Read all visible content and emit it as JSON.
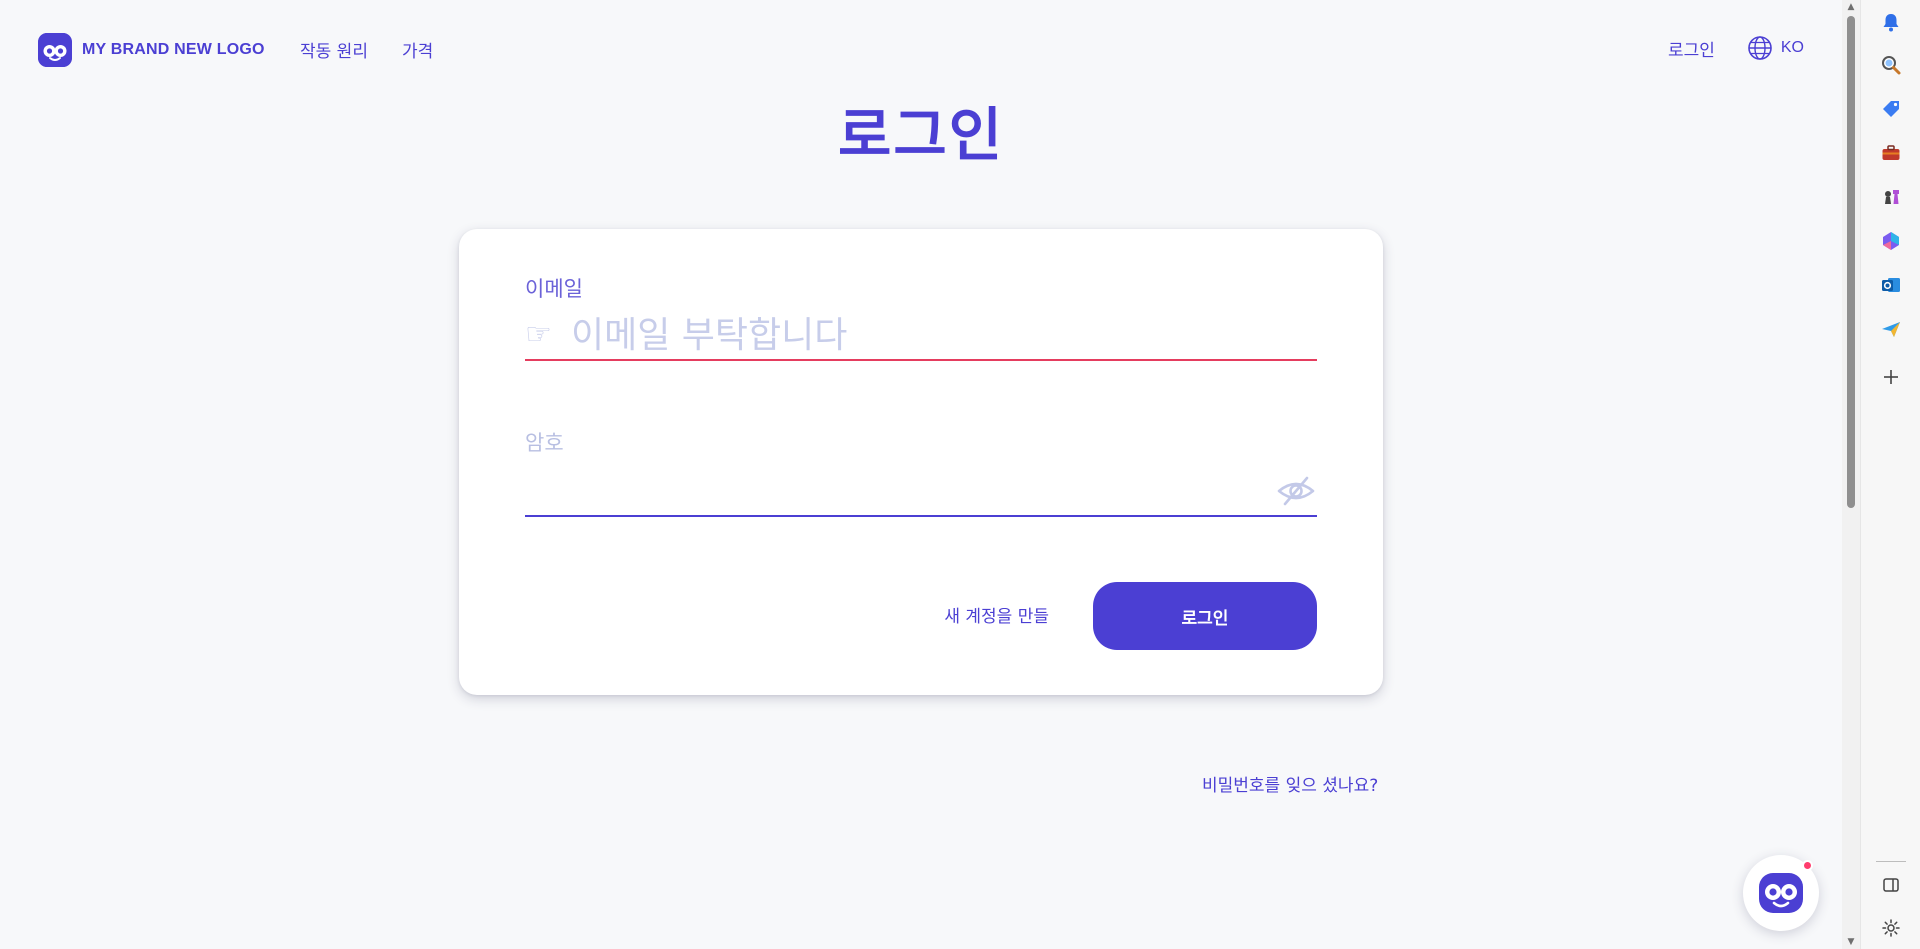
{
  "header": {
    "brand": {
      "name": "MY BRAND NEW LOGO",
      "logo_icon": "mascot-logo-icon"
    },
    "nav": [
      {
        "label": "작동 원리"
      },
      {
        "label": "가격"
      }
    ],
    "login_label": "로그인",
    "language": {
      "code": "KO",
      "icon": "globe-icon"
    }
  },
  "page": {
    "title": "로그인"
  },
  "form": {
    "email": {
      "label": "이메일",
      "placeholder": "이메일 부탁합니다",
      "value": "",
      "icon": "pointing-hand-icon",
      "icon_glyph": "☞",
      "error_color": "#e53d5e"
    },
    "password": {
      "label": "암호",
      "value": "",
      "toggle_icon": "eye-off-icon"
    },
    "create_account_label": "새 계정을 만들",
    "submit_label": "로그인"
  },
  "footer": {
    "forgot_password": "비밀번호를 잊으 셨나요?"
  },
  "chat_widget": {
    "icon": "mascot-chat-icon",
    "has_notification": true
  },
  "side_panel": {
    "icons": [
      "bell-icon",
      "search-icon",
      "tag-icon",
      "briefcase-icon",
      "chess-icon",
      "copilot-icon",
      "outlook-icon",
      "paper-plane-icon",
      "plus-icon",
      "sidebar-toggle-icon",
      "settings-icon"
    ]
  },
  "colors": {
    "brand": "#4b3fd3",
    "error": "#e53d5e",
    "placeholder": "#c7cdea",
    "background": "#f7f8fa",
    "card": "#ffffff"
  }
}
